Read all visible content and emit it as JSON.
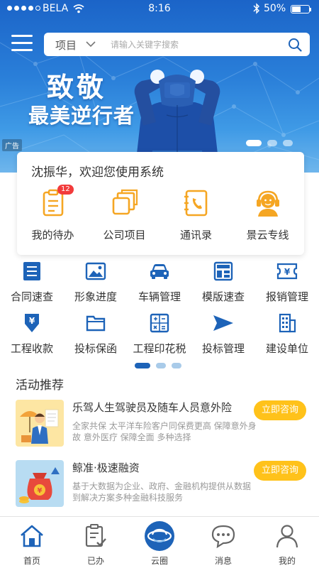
{
  "status_bar": {
    "carrier": "BELA",
    "time": "8:16",
    "battery": "50%"
  },
  "search": {
    "scope": "项目",
    "placeholder": "请输入关键字搜索"
  },
  "banner": {
    "line1": "致敬",
    "line2": "最美逆行者",
    "ad_tag": "广告",
    "slide_count": 3,
    "active_slide": 1
  },
  "welcome": {
    "text": "沈振华，欢迎您使用系统",
    "items": [
      {
        "label": "我的待办",
        "icon": "clipboard-icon",
        "badge": "12"
      },
      {
        "label": "公司项目",
        "icon": "layers-icon"
      },
      {
        "label": "通讯录",
        "icon": "phonebook-icon"
      },
      {
        "label": "景云专线",
        "icon": "headset-icon"
      }
    ]
  },
  "grid": {
    "row1": [
      {
        "label": "合同速查",
        "icon": "list-icon"
      },
      {
        "label": "形象进度",
        "icon": "image-icon"
      },
      {
        "label": "车辆管理",
        "icon": "car-icon"
      },
      {
        "label": "模版速查",
        "icon": "template-icon"
      },
      {
        "label": "报销管理",
        "icon": "ticket-icon"
      }
    ],
    "row2": [
      {
        "label": "工程收款",
        "icon": "yen-down-icon"
      },
      {
        "label": "投标保函",
        "icon": "folder-icon"
      },
      {
        "label": "工程印花税",
        "icon": "calculator-icon"
      },
      {
        "label": "投标管理",
        "icon": "send-icon"
      },
      {
        "label": "建设单位",
        "icon": "building-icon"
      }
    ],
    "page_count": 3,
    "active_page": 1
  },
  "activities": {
    "title": "活动推荐",
    "items": [
      {
        "title": "乐驾人生驾驶员及随车人员意外险",
        "desc": "全家共保 太平洋车险客户同保费更高 保障意外身故 意外医疗 保障全面 多种选择",
        "button": "立即咨询",
        "thumb": "insurance-person-icon"
      },
      {
        "title": "鲸准·极速融资",
        "desc": "基于大数据为企业、政府、金融机构提供从数据到解决方案多种金融科技服务",
        "button": "立即咨询",
        "thumb": "money-bag-icon"
      }
    ]
  },
  "tabbar": [
    {
      "label": "首页",
      "icon": "home-icon",
      "active": true
    },
    {
      "label": "已办",
      "icon": "done-list-icon"
    },
    {
      "label": "云圈",
      "icon": "cloud-circle-icon"
    },
    {
      "label": "消息",
      "icon": "chat-icon"
    },
    {
      "label": "我的",
      "icon": "user-icon"
    }
  ],
  "colors": {
    "primary": "#1d63b8",
    "banner_top": "#1b64c8",
    "accent_yellow": "#ffc21a",
    "badge_red": "#f23b3b",
    "icon_orange": "#f5a623"
  }
}
